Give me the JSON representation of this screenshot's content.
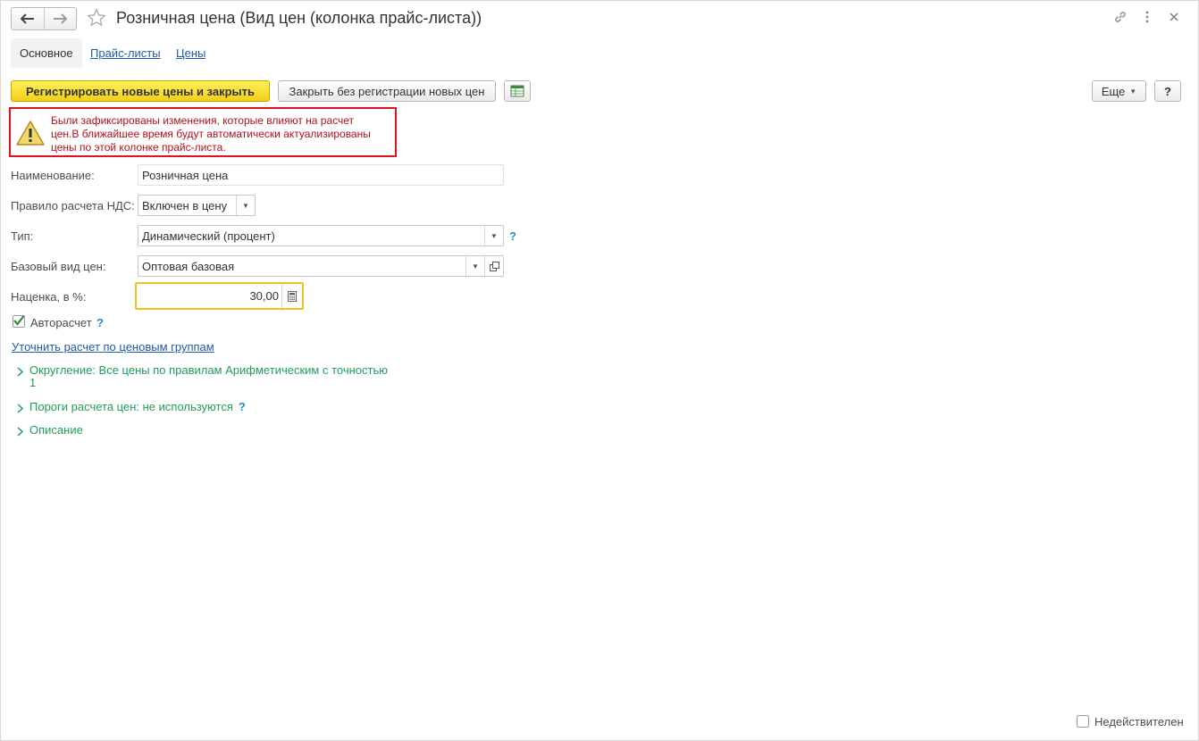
{
  "window": {
    "title": "Розничная цена (Вид цен (колонка прайс-листа))"
  },
  "tabs": [
    {
      "label": "Основное",
      "active": true
    },
    {
      "label": "Прайс-листы",
      "active": false
    },
    {
      "label": "Цены",
      "active": false
    }
  ],
  "toolbar": {
    "primary_label": "Регистрировать новые цены и закрыть",
    "secondary_label": "Закрыть без регистрации новых цен",
    "more_label": "Еще",
    "help_label": "?"
  },
  "warning": {
    "line1": "Были зафиксированы изменения, которые влияют на расчет",
    "line2": "цен.В ближайшее время будут автоматически актуализированы",
    "line3": "цены по этой колонке прайс-листа."
  },
  "form": {
    "name_label": "Наименование:",
    "name_value": "Розничная цена",
    "vat_label": "Правило расчета НДС:",
    "vat_value": "Включен в цену",
    "type_label": "Тип:",
    "type_value": "Динамический (процент)",
    "type_help": "?",
    "base_label": "Базовый вид цен:",
    "base_value": "Оптовая базовая",
    "markup_label": "Наценка, в %:",
    "markup_value": "30,00",
    "autocalc_label": "Авторасчет",
    "autocalc_checked": true,
    "autocalc_help": "?",
    "refine_link": "Уточнить расчет по ценовым группам"
  },
  "groups": [
    {
      "line1": "Округление: Все цены по правилам Арифметическим с точностью",
      "line2": "1"
    },
    {
      "line1": "Пороги расчета цен: не используются",
      "help": "?"
    },
    {
      "line1": "Описание"
    }
  ],
  "footer": {
    "inactive_label": "Недействителен",
    "inactive_checked": false
  },
  "colors": {
    "accent_yellow": "#f2cf17",
    "warning_border": "#e0141e",
    "warning_text": "#b3101a",
    "link_blue": "#1f5aa8",
    "group_green": "#1e9e5a",
    "help_blue": "#1c8fc4",
    "focus_border": "#f0c020"
  },
  "icons": {
    "back": "arrow-left-icon",
    "forward": "arrow-right-icon",
    "favorite": "star-icon",
    "link": "link-icon",
    "menu": "more-icon",
    "close": "close-icon",
    "report": "table-icon",
    "warning": "warning-icon",
    "calculator": "calculator-icon",
    "open": "open-window-icon",
    "expand": "chevron-right-icon",
    "check": "check-icon"
  }
}
